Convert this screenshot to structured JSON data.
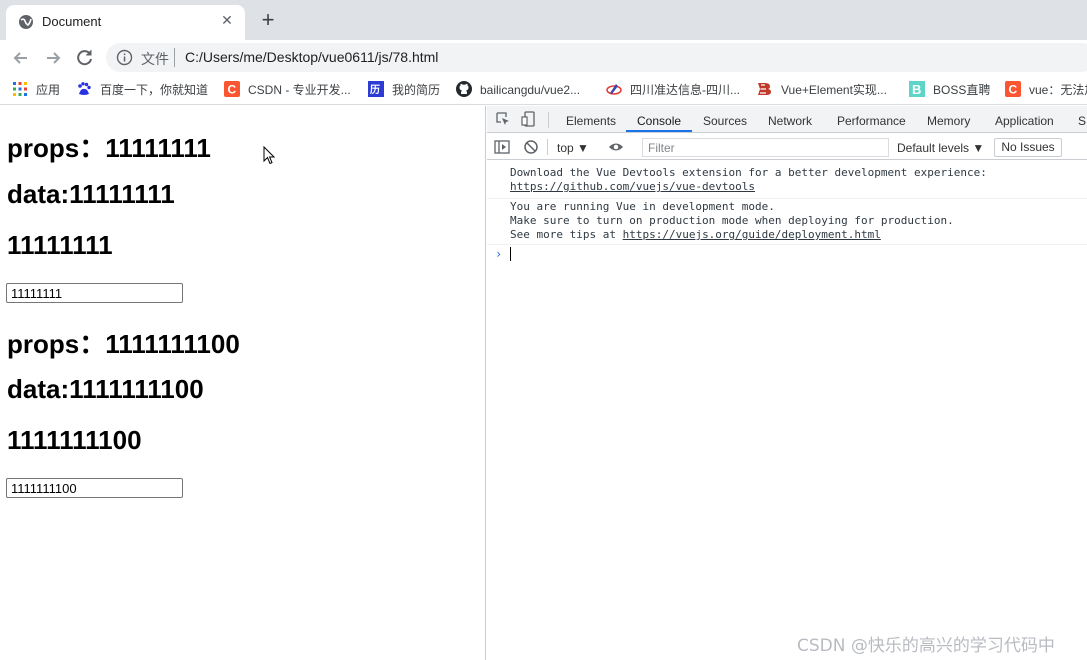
{
  "tab": {
    "title": "Document",
    "close_glyph": "✕",
    "new_tab_glyph": "+"
  },
  "omnibox": {
    "chip": "文件",
    "url": "C:/Users/me/Desktop/vue0611/js/78.html"
  },
  "bookmarks": [
    {
      "label": "应用",
      "icon": "apps-grid-icon"
    },
    {
      "label": "百度一下，你就知道",
      "icon": "baidu-paw-icon"
    },
    {
      "label": "CSDN - 专业开发...",
      "icon": "csdn-c-icon"
    },
    {
      "label": "我的简历",
      "icon": "resume-icon"
    },
    {
      "label": "bailicangdu/vue2...",
      "icon": "github-icon"
    },
    {
      "label": "四川准达信息-四川...",
      "icon": "zhunda-icon"
    },
    {
      "label": "Vue+Element实现...",
      "icon": "vue-element-icon"
    },
    {
      "label": "BOSS直聘",
      "icon": "boss-b-icon"
    },
    {
      "label": "vue：无法加",
      "icon": "csdn-c-icon"
    }
  ],
  "page": {
    "sections": [
      {
        "props_text": "props：11111111",
        "data_text": "data:11111111",
        "value_text": "11111111",
        "input_value": "11111111"
      },
      {
        "props_text": "props：1111111100",
        "data_text": "data:1111111100",
        "value_text": "1111111100",
        "input_value": "1111111100"
      }
    ]
  },
  "devtools": {
    "tabs": [
      "Elements",
      "Console",
      "Sources",
      "Network",
      "Performance",
      "Memory",
      "Application",
      "S"
    ],
    "active_tab": "Console",
    "context": "top ▼",
    "filter_placeholder": "Filter",
    "levels": "Default levels ▼",
    "issues": "No Issues",
    "messages": [
      {
        "lines": [
          "Download the Vue Devtools extension for a better development experience:"
        ],
        "link": "https://github.com/vuejs/vue-devtools"
      },
      {
        "lines": [
          "You are running Vue in development mode.",
          "Make sure to turn on production mode when deploying for production.",
          "See more tips at "
        ],
        "link": "https://vuejs.org/guide/deployment.html"
      }
    ],
    "prompt": "›"
  },
  "watermark": "CSDN @快乐的高兴的学习代码中",
  "colors": {
    "accent": "#1a73e8",
    "tabstrip": "#dee1e6",
    "omnibox": "#f1f3f4"
  }
}
